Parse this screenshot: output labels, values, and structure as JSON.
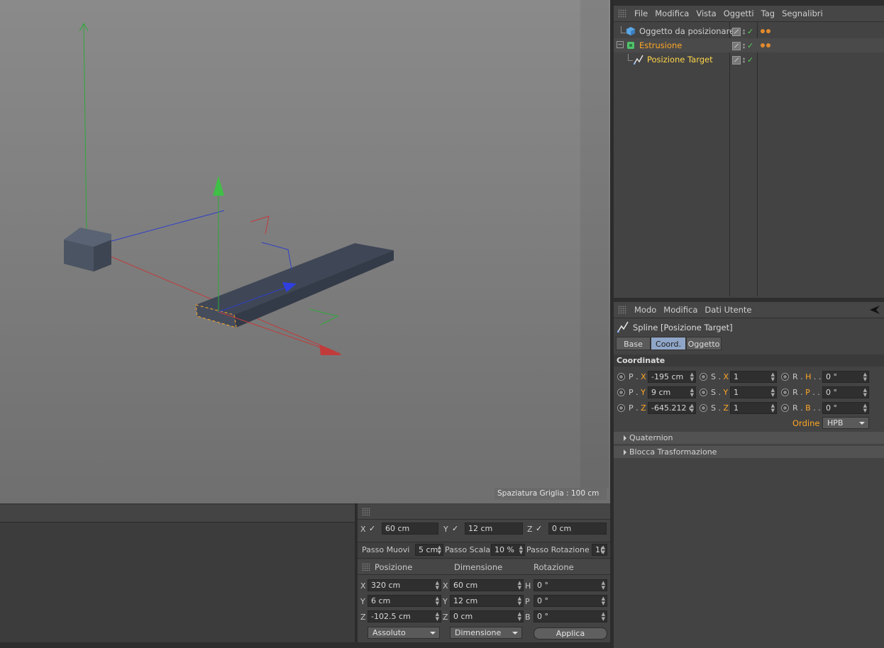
{
  "viewport": {
    "grid_spacing_label": "Spaziatura Griglia : 100 cm"
  },
  "object_manager": {
    "menu": [
      "File",
      "Modifica",
      "Vista",
      "Oggetti",
      "Tag",
      "Segnalibri"
    ],
    "objects": [
      {
        "name": "Oggetto da posizionare",
        "color": "#cfcfcf"
      },
      {
        "name": "Estrusione",
        "color": "#ffa726"
      },
      {
        "name": "Posizione Target",
        "color": "#ffd54a"
      }
    ]
  },
  "attribute_manager": {
    "menu": [
      "Modo",
      "Modifica",
      "Dati Utente"
    ],
    "title": "Spline [Posizione Target]",
    "tabs": [
      "Base",
      "Coord.",
      "Oggetto"
    ],
    "active_tab": "Coord.",
    "section": "Coordinate",
    "rows": [
      {
        "p_label": "P",
        "p_axis": "X",
        "p_value": "-195 cm",
        "s_label": "S",
        "s_axis": "X",
        "s_value": "1",
        "r_label": "R",
        "r_axis": "H",
        "r_value": "0 °"
      },
      {
        "p_label": "P",
        "p_axis": "Y",
        "p_value": "9 cm",
        "s_label": "S",
        "s_axis": "Y",
        "s_value": "1",
        "r_label": "R",
        "r_axis": "P",
        "r_value": "0 °"
      },
      {
        "p_label": "P",
        "p_axis": "Z",
        "p_value": "-645.212 c",
        "s_label": "S",
        "s_axis": "Z",
        "s_value": "1",
        "r_label": "R",
        "r_axis": "B",
        "r_value": "0 °"
      }
    ],
    "order_label": "Ordine",
    "order_value": "HPB",
    "collapsed": [
      "Quaternion",
      "Blocca Trasformazione"
    ]
  },
  "snap_panel": {
    "axes": [
      {
        "label": "X",
        "value": "60 cm"
      },
      {
        "label": "Y",
        "value": "12 cm"
      },
      {
        "label": "Z",
        "value": "0 cm"
      }
    ],
    "steps": [
      {
        "label": "Passo Muovi",
        "value": "5 cm"
      },
      {
        "label": "Passo Scala",
        "value": "10 %"
      },
      {
        "label": "Passo Rotazione",
        "value": "1("
      }
    ]
  },
  "coord_manager": {
    "headers": [
      "Posizione",
      "Dimensione",
      "Rotazione"
    ],
    "rows": [
      {
        "a1": "X",
        "v1": "320 cm",
        "a2": "X",
        "v2": "60 cm",
        "a3": "H",
        "v3": "0 °"
      },
      {
        "a1": "Y",
        "v1": "6 cm",
        "a2": "Y",
        "v2": "12 cm",
        "a3": "P",
        "v3": "0 °"
      },
      {
        "a1": "Z",
        "v1": "-102.5 cm",
        "a2": "Z",
        "v2": "0 cm",
        "a3": "B",
        "v3": "0 °"
      }
    ],
    "mode_value": "Assoluto",
    "size_value": "Dimensione",
    "apply_label": "Applica"
  },
  "colors": {
    "axis_x": "#c23b3b",
    "axis_y": "#2fa83a",
    "axis_z": "#2f3fc8",
    "highlight": "#ffa726"
  }
}
